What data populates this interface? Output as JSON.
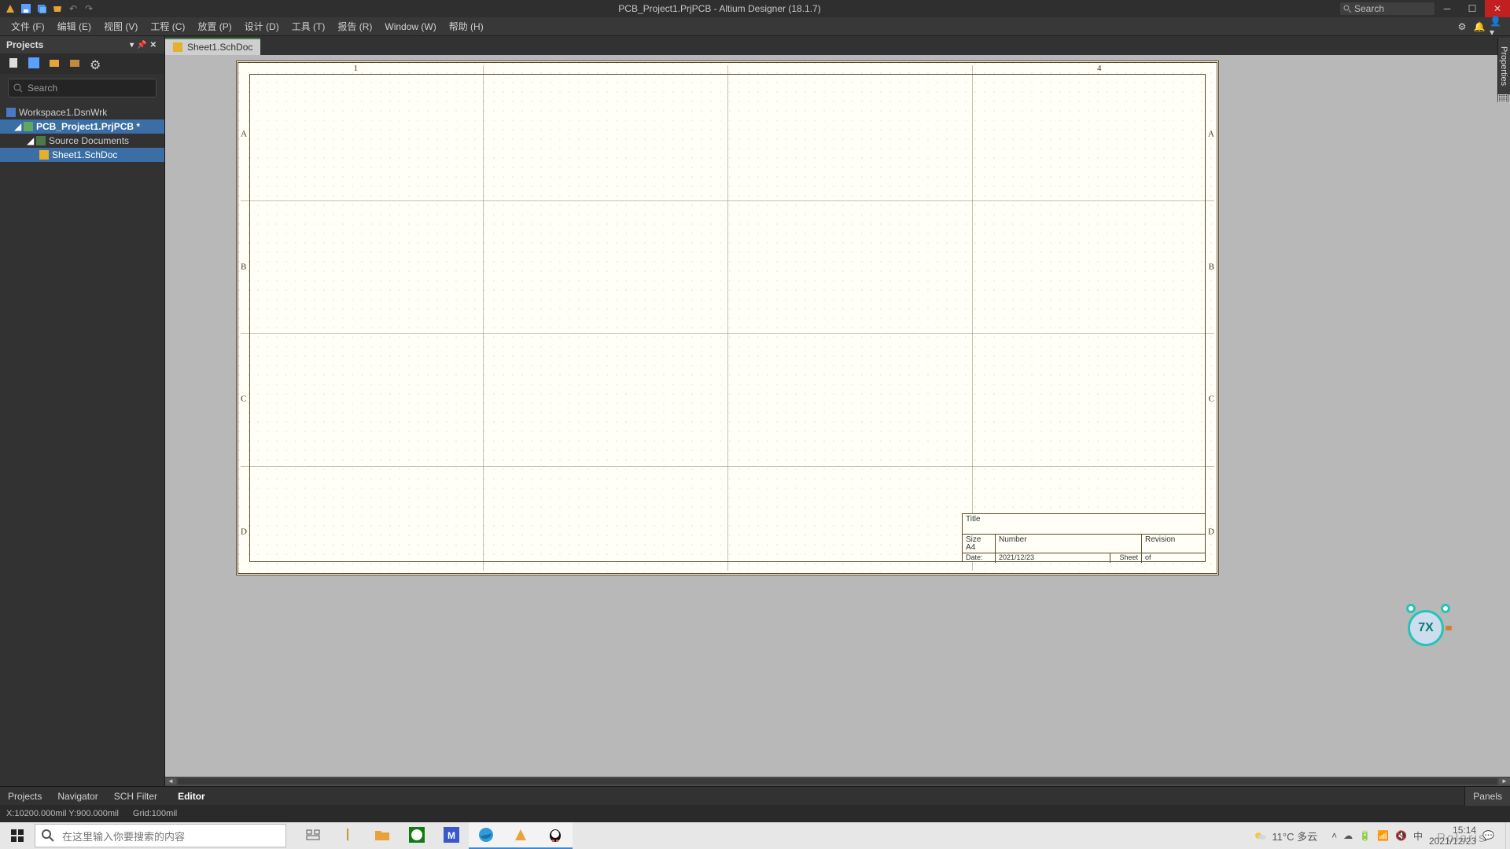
{
  "app": {
    "title": "PCB_Project1.PrjPCB - Altium Designer (18.1.7)",
    "search_placeholder": "Search"
  },
  "menu": {
    "file": "文件 (F)",
    "edit": "编辑 (E)",
    "view": "视图 (V)",
    "project": "工程 (C)",
    "place": "放置 (P)",
    "design": "设计 (D)",
    "tools": "工具 (T)",
    "reports": "报告 (R)",
    "window": "Window (W)",
    "help": "帮助 (H)"
  },
  "panel": {
    "title": "Projects",
    "search_placeholder": "Search",
    "workspace": "Workspace1.DsnWrk",
    "project": "PCB_Project1.PrjPCB *",
    "folder": "Source Documents",
    "doc": "Sheet1.SchDoc"
  },
  "doc": {
    "tab": "Sheet1.SchDoc",
    "col1": "1",
    "col4": "4",
    "rowA": "A",
    "rowB": "B",
    "rowC": "C",
    "rowD": "D"
  },
  "titleblock": {
    "title_lbl": "Title",
    "size_lbl": "Size",
    "size_val": "A4",
    "number_lbl": "Number",
    "rev_lbl": "Revision",
    "date_lbl": "Date:",
    "date_val": "2021/12/23",
    "sheet_lbl": "Sheet",
    "of_lbl": "of"
  },
  "property_tab": "Properties",
  "bottom": {
    "projects": "Projects",
    "navigator": "Navigator",
    "filter": "SCH Filter",
    "editor": "Editor",
    "panels": "Panels"
  },
  "status": {
    "xy": "X:10200.000mil  Y:900.000mil",
    "grid": "Grid:100mil"
  },
  "taskbar": {
    "search_placeholder": "在这里输入你要搜索的内容",
    "weather": "11°C 多云",
    "ime": "中",
    "time": "15:14",
    "date": "2021/12/23",
    "watermark": "Polaris"
  },
  "mascot": {
    "label": "7X"
  }
}
